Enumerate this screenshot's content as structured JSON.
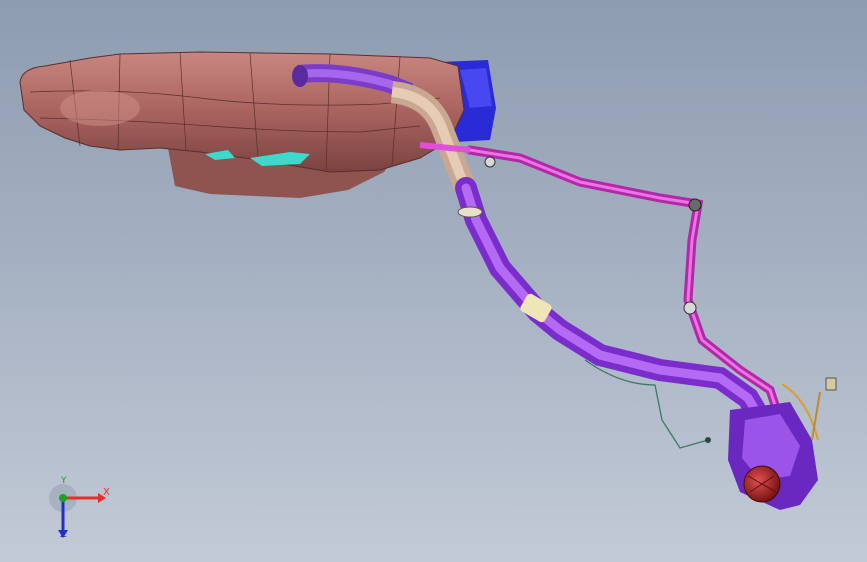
{
  "viewport": {
    "background_top": "#8e9cb0",
    "background_bottom": "#c2cad6"
  },
  "model": {
    "tank_color": "#b06c68",
    "filler_pipe_color": "#9b3fe6",
    "vent_line_color": "#e050d8",
    "bracket_color": "#2a2ad6",
    "fuel_cap_color": "#b82828"
  },
  "triad": {
    "x_label": "X",
    "y_label": "Y",
    "z_label": "Z",
    "x_color": "#e03030",
    "y_color": "#20a020",
    "z_color": "#2030d0"
  }
}
